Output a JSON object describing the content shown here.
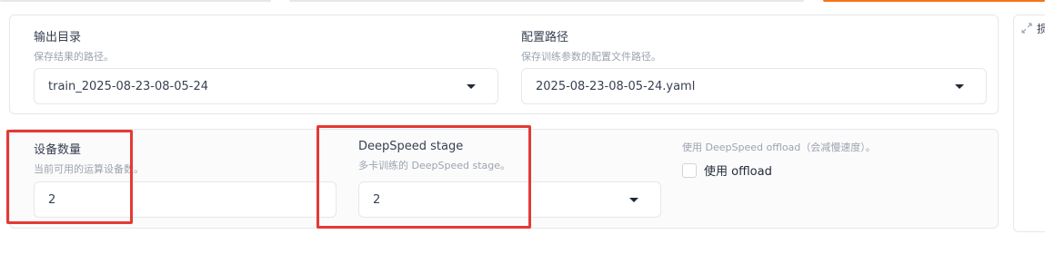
{
  "output_dir": {
    "label": "输出目录",
    "info": "保存结果的路径。",
    "value": "train_2025-08-23-08-05-24"
  },
  "config_path": {
    "label": "配置路径",
    "info": "保存训练参数的配置文件路径。",
    "value": "2025-08-23-08-05-24.yaml"
  },
  "device_count": {
    "label": "设备数量",
    "info": "当前可用的运算设备数。",
    "value": "2"
  },
  "ds_stage": {
    "label": "DeepSpeed stage",
    "info": "多卡训练的 DeepSpeed stage。",
    "value": "2"
  },
  "ds_offload": {
    "info": "使用 DeepSpeed offload（会减慢速度）。",
    "checkbox_label": "使用 offload",
    "checked": false
  },
  "side_panel": {
    "icon": "expand-icon",
    "text": "损"
  },
  "colors": {
    "highlight": "#e53935",
    "accent_strip": "#f97316"
  }
}
